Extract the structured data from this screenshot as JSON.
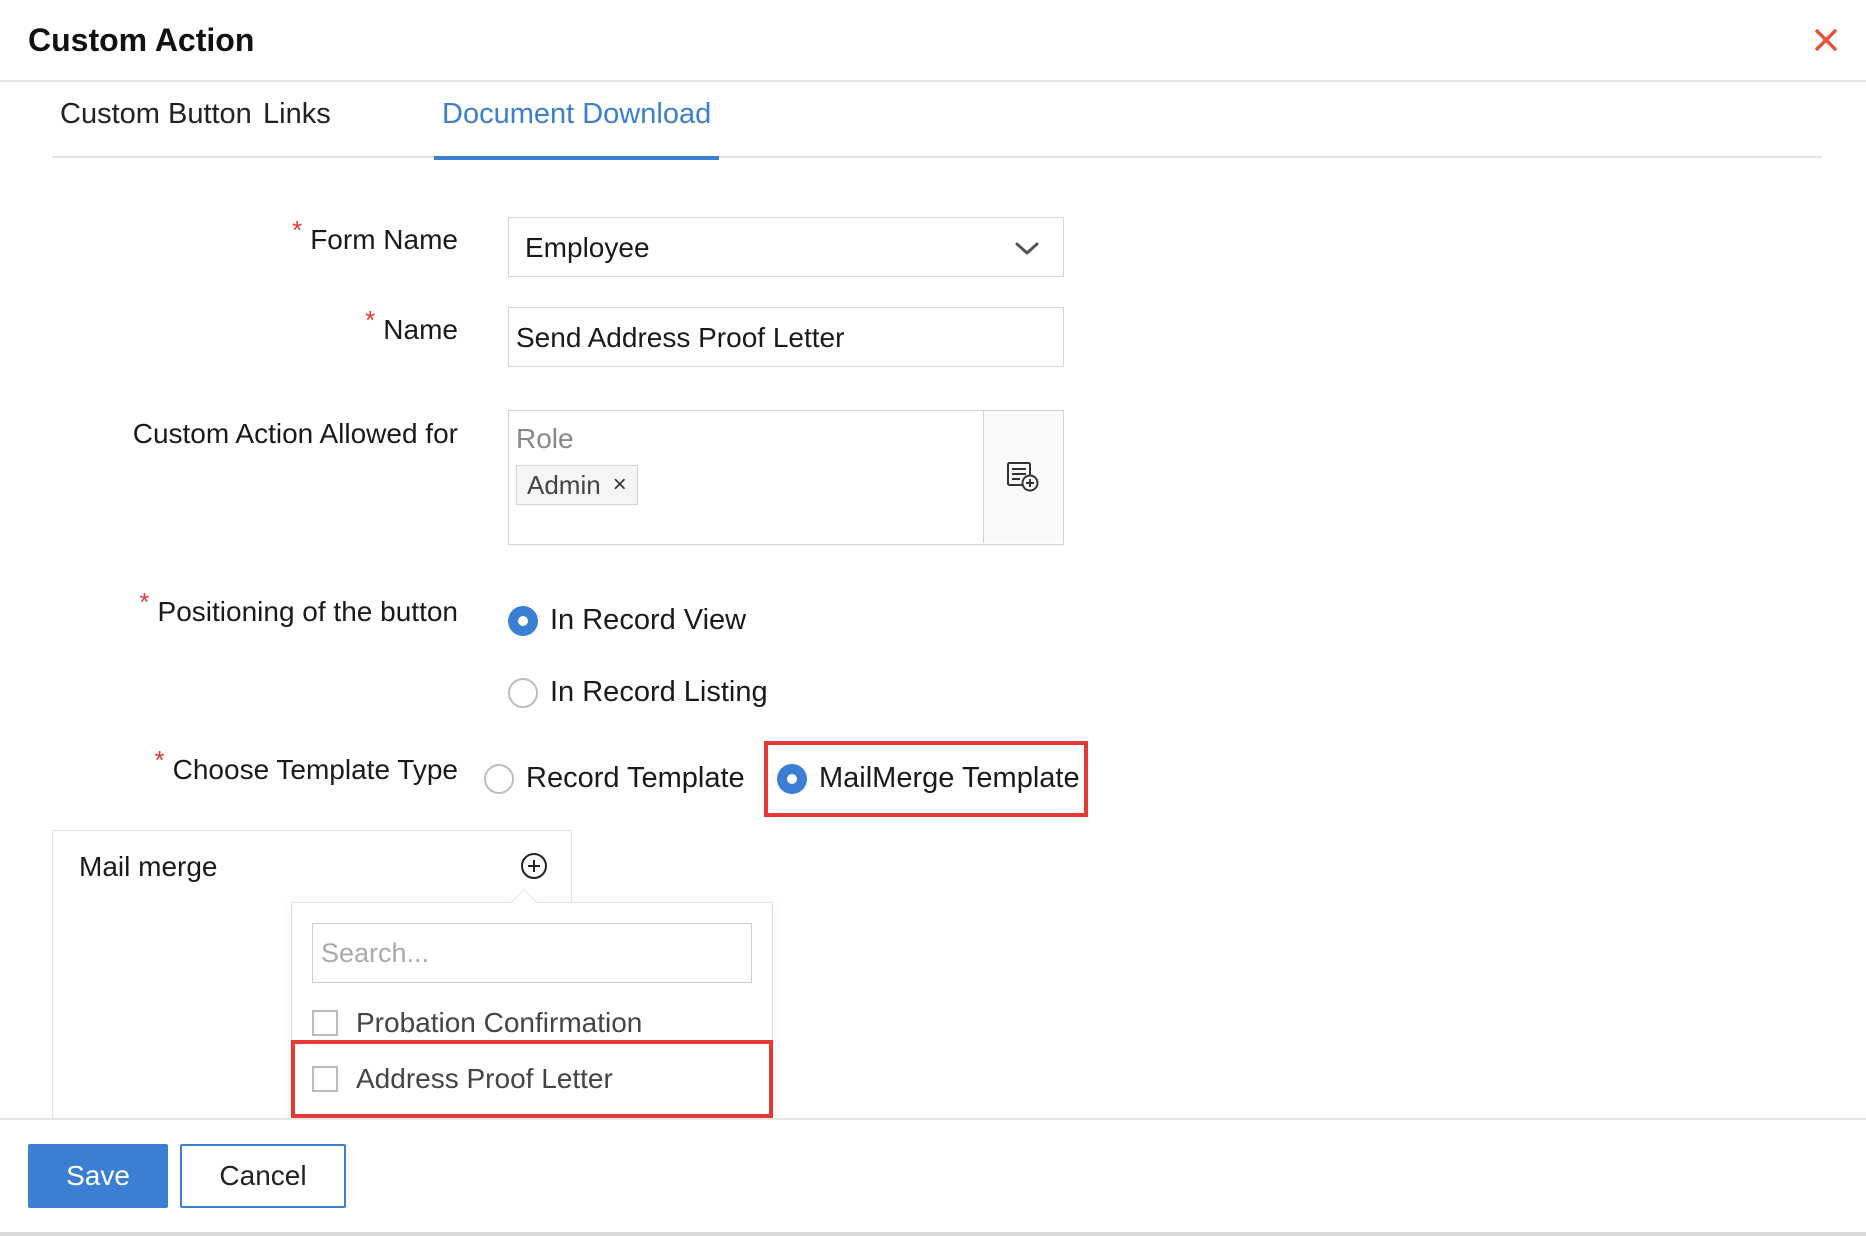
{
  "dialog": {
    "title": "Custom Action",
    "close_icon": "close-icon",
    "accent_color": "#3b7fd4",
    "required_color": "#e53935"
  },
  "tabs": [
    {
      "label": "Custom Button",
      "active": false
    },
    {
      "label": "Links",
      "active": false
    },
    {
      "label": "Document Download",
      "active": true
    }
  ],
  "form": {
    "form_name": {
      "label": "Form Name",
      "required": true,
      "value": "Employee"
    },
    "name": {
      "label": "Name",
      "required": true,
      "value": "Send Address Proof Letter"
    },
    "allowed_for": {
      "label": "Custom Action Allowed for",
      "placeholder": "Role",
      "chips": [
        "Admin"
      ],
      "chip_remove": "×",
      "picker_icon": "list-add-icon"
    },
    "positioning": {
      "label": "Positioning of the button",
      "required": true,
      "options": [
        {
          "label": "In Record View",
          "selected": true
        },
        {
          "label": "In Record Listing",
          "selected": false
        }
      ]
    },
    "template_type": {
      "label": "Choose Template Type",
      "required": true,
      "options": [
        {
          "label": "Record Template",
          "selected": false
        },
        {
          "label": "MailMerge Template",
          "selected": true
        }
      ]
    }
  },
  "mail_merge": {
    "title": "Mail merge",
    "add_icon": "plus-circle-icon",
    "search_placeholder": "Search...",
    "options": [
      {
        "label": "Probation Confirmation",
        "checked": false
      },
      {
        "label": "Address Proof Letter",
        "checked": false
      }
    ]
  },
  "footer": {
    "save_label": "Save",
    "cancel_label": "Cancel"
  }
}
